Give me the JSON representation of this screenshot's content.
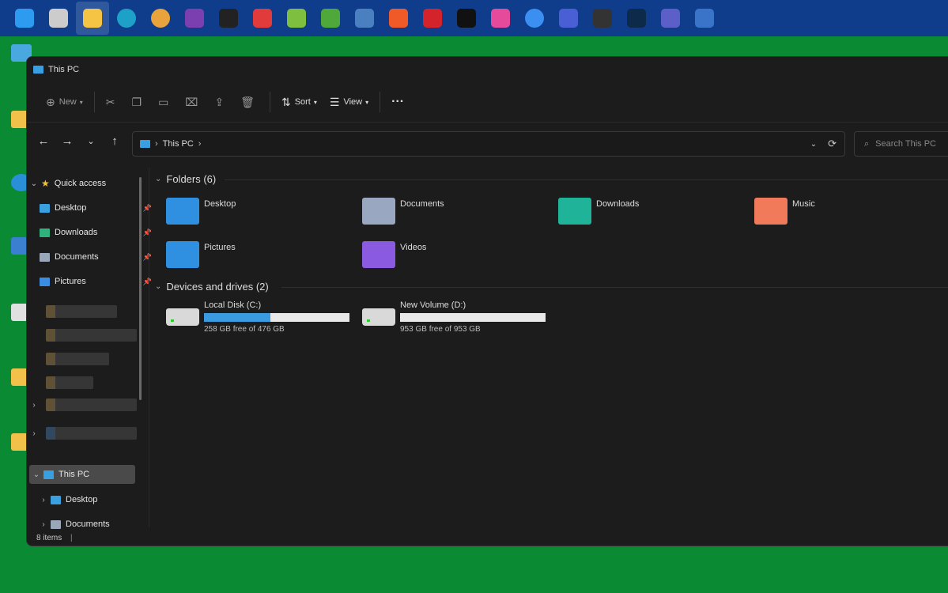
{
  "taskbar": {
    "icons": [
      {
        "name": "start-icon",
        "color": "#2d9cf0"
      },
      {
        "name": "task-view-icon",
        "color": "#cccccc"
      },
      {
        "name": "file-explorer-icon",
        "color": "#f6c445"
      },
      {
        "name": "edge-icon",
        "color": "#1da1c8"
      },
      {
        "name": "chrome-icon",
        "color": "#e8a33c"
      },
      {
        "name": "app-purple-icon",
        "color": "#7b3fb0"
      },
      {
        "name": "app-w-icon",
        "color": "#222222"
      },
      {
        "name": "app-red-icon",
        "color": "#e23b3b"
      },
      {
        "name": "bluestacks-icon",
        "color": "#7fbf3f"
      },
      {
        "name": "app-green-icon",
        "color": "#4fa83a"
      },
      {
        "name": "app-image-icon",
        "color": "#4a7fc0"
      },
      {
        "name": "brave-icon",
        "color": "#f05a28"
      },
      {
        "name": "acrobat-icon",
        "color": "#d4232b"
      },
      {
        "name": "vectr-icon",
        "color": "#111111"
      },
      {
        "name": "app-colorful-icon",
        "color": "#e64a9a"
      },
      {
        "name": "messenger-icon",
        "color": "#3a8ff0"
      },
      {
        "name": "app-chart-icon",
        "color": "#4a5fd6"
      },
      {
        "name": "clapper-icon",
        "color": "#333333"
      },
      {
        "name": "photoshop-icon",
        "color": "#0d2a4a"
      },
      {
        "name": "teams-icon",
        "color": "#5b5fc7"
      },
      {
        "name": "document-icon",
        "color": "#3a74c9"
      }
    ]
  },
  "window": {
    "title": "This PC",
    "toolbar": {
      "new_label": "New",
      "sort_label": "Sort",
      "view_label": "View",
      "more_label": "···"
    },
    "address": {
      "path_label": "This PC"
    },
    "search": {
      "placeholder": "Search This PC"
    },
    "sidebar": {
      "quick_access": "Quick access",
      "pinned": [
        {
          "label": "Desktop",
          "color": "#3aa0e0"
        },
        {
          "label": "Downloads",
          "color": "#2fb37c"
        },
        {
          "label": "Documents",
          "color": "#9aa7b8"
        },
        {
          "label": "Pictures",
          "color": "#3a8de0"
        }
      ],
      "this_pc": "This PC",
      "children": [
        {
          "label": "Desktop",
          "color": "#3aa0e0"
        },
        {
          "label": "Documents",
          "color": "#9aa7b8"
        }
      ]
    },
    "folders": {
      "heading": "Folders (6)",
      "items": [
        {
          "label": "Desktop",
          "color": "#2f8fe0"
        },
        {
          "label": "Documents",
          "color": "#9aa7c0"
        },
        {
          "label": "Downloads",
          "color": "#1fb39a"
        },
        {
          "label": "Music",
          "color": "#f07a5a"
        },
        {
          "label": "Pictures",
          "color": "#2f8fe0"
        },
        {
          "label": "Videos",
          "color": "#8a5ae0"
        }
      ]
    },
    "drives": {
      "heading": "Devices and drives (2)",
      "items": [
        {
          "label": "Local Disk (C:)",
          "free": "258 GB free of 476 GB",
          "used_fraction": 0.458
        },
        {
          "label": "New Volume (D:)",
          "free": "953 GB free of 953 GB",
          "used_fraction": 0.0
        }
      ]
    },
    "status": "8 items"
  }
}
